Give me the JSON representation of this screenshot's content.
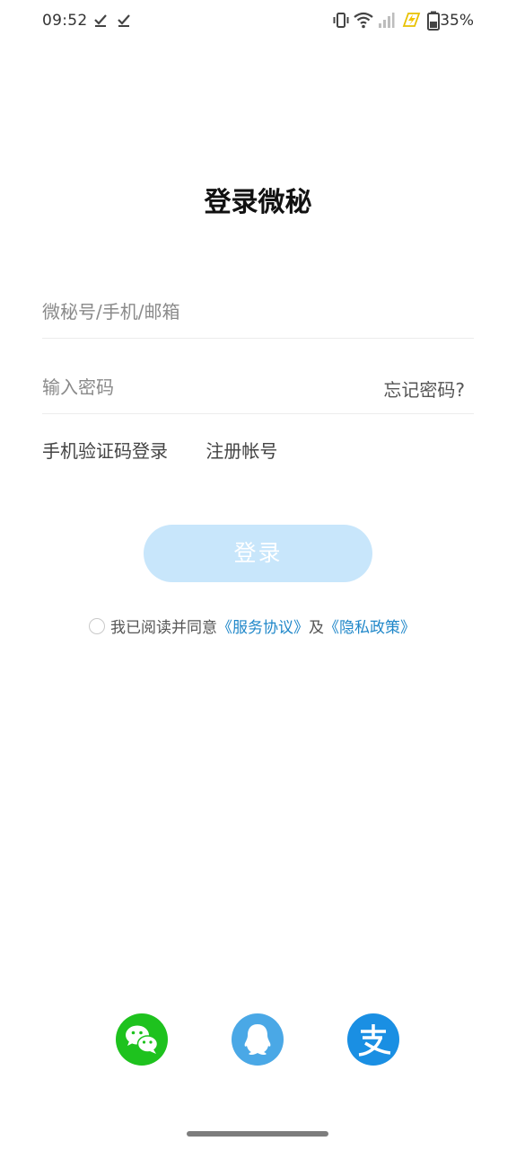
{
  "status_bar": {
    "time": "09:52",
    "battery": "35%",
    "icons": [
      "check-download-icon",
      "check-download-icon",
      "vibrate-icon",
      "wifi-icon",
      "signal-icon",
      "charging-icon",
      "battery-icon"
    ]
  },
  "title": "登录微秘",
  "form": {
    "account_placeholder": "微秘号/手机/邮箱",
    "account_value": "",
    "password_placeholder": "输入密码",
    "password_value": "",
    "forgot_label": "忘记密码?",
    "sms_login_label": "手机验证码登录",
    "register_label": "注册帐号",
    "login_button_label": "登录"
  },
  "agreement": {
    "prefix": "我已阅读并同意",
    "service_link": "《服务协议》",
    "conjunction": "及",
    "privacy_link": "《隐私政策》",
    "checked": false
  },
  "social_logins": [
    {
      "name": "wechat",
      "icon": "wechat-icon",
      "color": "#1ec21e"
    },
    {
      "name": "qq",
      "icon": "qq-icon",
      "color": "#4aa8e6"
    },
    {
      "name": "alipay",
      "icon": "alipay-icon",
      "color": "#1a8fe3"
    }
  ],
  "colors": {
    "accent": "#1f87c9",
    "login_button_disabled": "#c8e6fb"
  }
}
